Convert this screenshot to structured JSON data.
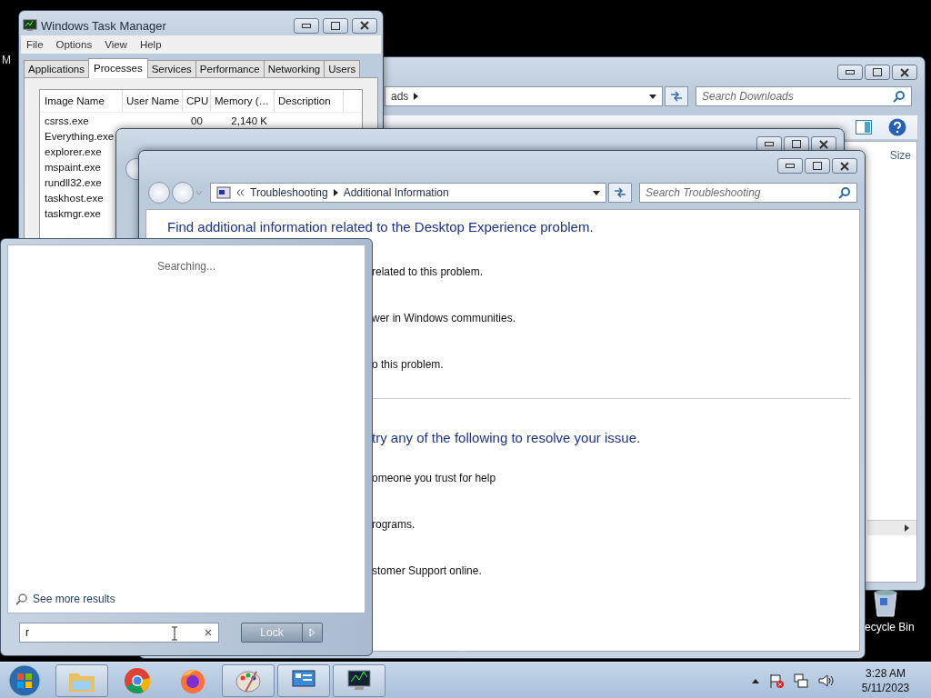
{
  "desktop": {
    "edge_text": "M",
    "recycle_bin": {
      "label": "ecycle Bin"
    }
  },
  "explorer": {
    "address": "ads",
    "search": {
      "placeholder": "Search Downloads"
    },
    "column": "Size"
  },
  "task_manager": {
    "title": "Windows Task Manager",
    "menu": [
      "File",
      "Options",
      "View",
      "Help"
    ],
    "tabs": [
      {
        "label": "Applications",
        "selected": false
      },
      {
        "label": "Processes",
        "selected": true
      },
      {
        "label": "Services",
        "selected": false
      },
      {
        "label": "Performance",
        "selected": false
      },
      {
        "label": "Networking",
        "selected": false
      },
      {
        "label": "Users",
        "selected": false
      }
    ],
    "columns": [
      "Image Name",
      "User Name",
      "CPU",
      "Memory (…",
      "Description"
    ],
    "rows": [
      {
        "name": "csrss.exe",
        "cpu": "00",
        "memory": "2,140 K"
      },
      {
        "name": "Everything.exe"
      },
      {
        "name": "explorer.exe"
      },
      {
        "name": "mspaint.exe"
      },
      {
        "name": "rundll32.exe"
      },
      {
        "name": "taskhost.exe"
      },
      {
        "name": "taskmgr.exe"
      }
    ]
  },
  "troubleshooting": {
    "breadcrumb": [
      "Troubleshooting",
      "Additional Information"
    ],
    "search": {
      "placeholder": "Search Troubleshooting"
    },
    "heading": "Find additional information related to the Desktop Experience problem.",
    "items": [
      "related to this problem.",
      "wer in Windows communities.",
      "o this problem."
    ],
    "heading_2": "try any of the following to resolve your issue.",
    "items_2": [
      "omeone you trust for help",
      "rograms.",
      "stomer Support online."
    ]
  },
  "start_menu": {
    "status": "Searching...",
    "more_results": "See more results",
    "search": {
      "value": "r"
    },
    "power_button": "Lock"
  },
  "taskbar": {
    "apps": [
      {
        "kind": "folder",
        "running": true
      },
      {
        "kind": "chrome",
        "running": false
      },
      {
        "kind": "firefox",
        "running": false
      },
      {
        "kind": "paint",
        "running": true
      },
      {
        "kind": "control",
        "running": true
      },
      {
        "kind": "monitor",
        "running": true
      }
    ],
    "time": "3:28 AM",
    "date": "5/11/2023"
  }
}
